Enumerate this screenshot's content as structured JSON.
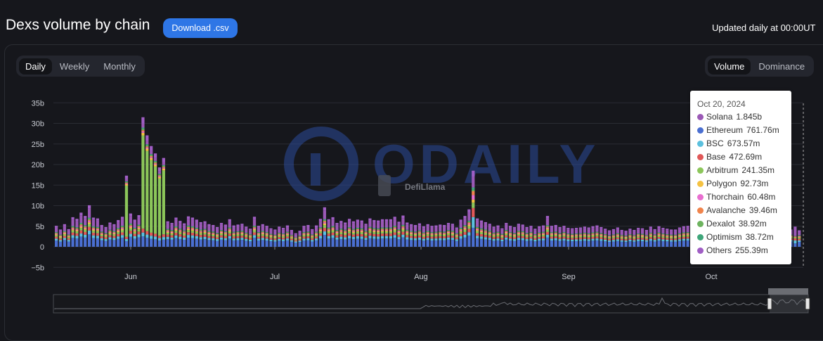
{
  "header": {
    "title": "Dexs volume by chain",
    "download_label": "Download .csv",
    "updated_text": "Updated daily at 00:00UT"
  },
  "period_tabs": [
    "Daily",
    "Weekly",
    "Monthly"
  ],
  "period_active": "Daily",
  "mode_tabs": [
    "Volume",
    "Dominance"
  ],
  "mode_active": "Volume",
  "watermark": {
    "text": "ODAILY",
    "logo_text": "DefiLlama"
  },
  "tooltip": {
    "date": "Oct 20, 2024",
    "rows": [
      {
        "name": "Solana",
        "value": "1.845b",
        "color": "#9b59b6"
      },
      {
        "name": "Ethereum",
        "value": "761.76m",
        "color": "#4a6fd1"
      },
      {
        "name": "BSC",
        "value": "673.57m",
        "color": "#5bc0de"
      },
      {
        "name": "Base",
        "value": "472.69m",
        "color": "#e05858"
      },
      {
        "name": "Arbitrum",
        "value": "241.35m",
        "color": "#8cc65a"
      },
      {
        "name": "Polygon",
        "value": "92.73m",
        "color": "#f5c242"
      },
      {
        "name": "Thorchain",
        "value": "60.48m",
        "color": "#e86fd0"
      },
      {
        "name": "Avalanche",
        "value": "39.46m",
        "color": "#f0844c"
      },
      {
        "name": "Dexalot",
        "value": "38.92m",
        "color": "#6db35f"
      },
      {
        "name": "Optimism",
        "value": "38.72m",
        "color": "#3fa67a"
      },
      {
        "name": "Others",
        "value": "255.39m",
        "color": "#a05ec4"
      }
    ]
  },
  "chart_data": {
    "type": "bar",
    "stacked": true,
    "title": "Dexs volume by chain",
    "y_ticks": [
      "35b",
      "30b",
      "25b",
      "20b",
      "15b",
      "10b",
      "5b",
      "0",
      "−5b"
    ],
    "ylim": [
      -5,
      35
    ],
    "y_unit": "billions USD",
    "x_ticks": [
      "Jun",
      "Jul",
      "Aug",
      "Sep",
      "Oct"
    ],
    "grid": true,
    "series_order": [
      "Ethereum",
      "BSC",
      "Base",
      "Arbitrum",
      "Polygon",
      "Thorchain",
      "Avalanche",
      "Dexalot",
      "Optimism",
      "Solana",
      "Others"
    ],
    "series_colors": {
      "Ethereum": "#4a6fd1",
      "BSC": "#5bc0de",
      "Base": "#e05858",
      "Arbitrum": "#8cc65a",
      "Polygon": "#f5c242",
      "Thorchain": "#e86fd0",
      "Avalanche": "#f0844c",
      "Dexalot": "#6db35f",
      "Optimism": "#3fa67a",
      "Solana": "#9b59b6",
      "Others": "#a05ec4"
    },
    "totals": [
      5.1,
      4.2,
      5.5,
      4.3,
      7.2,
      6.8,
      8.3,
      7.5,
      10.1,
      7.1,
      6.9,
      5.3,
      4.8,
      5.9,
      5.5,
      6.5,
      7.3,
      17.3,
      8.1,
      6.6,
      7.7,
      31.5,
      27.1,
      24.5,
      22.7,
      19.3,
      21.6,
      6.2,
      5.8,
      7.1,
      6.3,
      5.7,
      7.4,
      7.1,
      6.6,
      6.0,
      6.2,
      5.5,
      5.3,
      4.8,
      5.8,
      5.4,
      6.7,
      5.2,
      5.4,
      5.6,
      4.9,
      4.4,
      7.3,
      5.1,
      5.5,
      5.1,
      4.5,
      4.2,
      4.9,
      4.6,
      5.2,
      4.1,
      3.3,
      3.9,
      5.1,
      5.3,
      4.3,
      5.2,
      6.8,
      9.6,
      6.7,
      7.2,
      5.8,
      6.3,
      5.9,
      6.8,
      6.2,
      6.6,
      6.4,
      5.6,
      6.9,
      6.5,
      6.4,
      6.7,
      6.7,
      6.7,
      7.3,
      6.1,
      7.6,
      5.9,
      5.5,
      5.3,
      5.7,
      5.0,
      5.5,
      5.1,
      5.2,
      5.4,
      5.3,
      5.8,
      5.6,
      4.7,
      6.6,
      7.5,
      9.1,
      18.5,
      6.9,
      6.4,
      6.0,
      5.6,
      4.9,
      5.2,
      4.5,
      5.8,
      5.1,
      4.8,
      5.6,
      5.4,
      4.8,
      5.1,
      4.4,
      5.0,
      5.2,
      7.5,
      5.1,
      5.3,
      4.8,
      5.1,
      4.6,
      4.5,
      4.6,
      4.7,
      4.9,
      4.7,
      5.0,
      5.2,
      4.8,
      4.4,
      4.0,
      4.3,
      4.7,
      4.1,
      3.9,
      4.4,
      4.1,
      4.6,
      4.5,
      4.1,
      4.9,
      4.3,
      5.0,
      4.6,
      4.4,
      4.2,
      4.2,
      4.7,
      5.0,
      5.1,
      4.2,
      5.1,
      5.5,
      5.3,
      5.2,
      4.8,
      4.8,
      5.3,
      4.5,
      3.9,
      5.1,
      4.6,
      4.9,
      4.5,
      4.6,
      5.1,
      5.6,
      5.4,
      5.1,
      4.7,
      6.1,
      4.6,
      4.4,
      4.0,
      4.2,
      4.9,
      4.0
    ],
    "highlighted_index": 179,
    "highlighted_date": "Oct 20, 2024",
    "highlighted_values": {
      "Solana": 1.845,
      "Ethereum": 0.76176,
      "BSC": 0.67357,
      "Base": 0.47269,
      "Arbitrum": 0.24135,
      "Polygon": 0.09273,
      "Thorchain": 0.06048,
      "Avalanche": 0.03946,
      "Dexalot": 0.03892,
      "Optimism": 0.03872,
      "Others": 0.25539
    }
  }
}
